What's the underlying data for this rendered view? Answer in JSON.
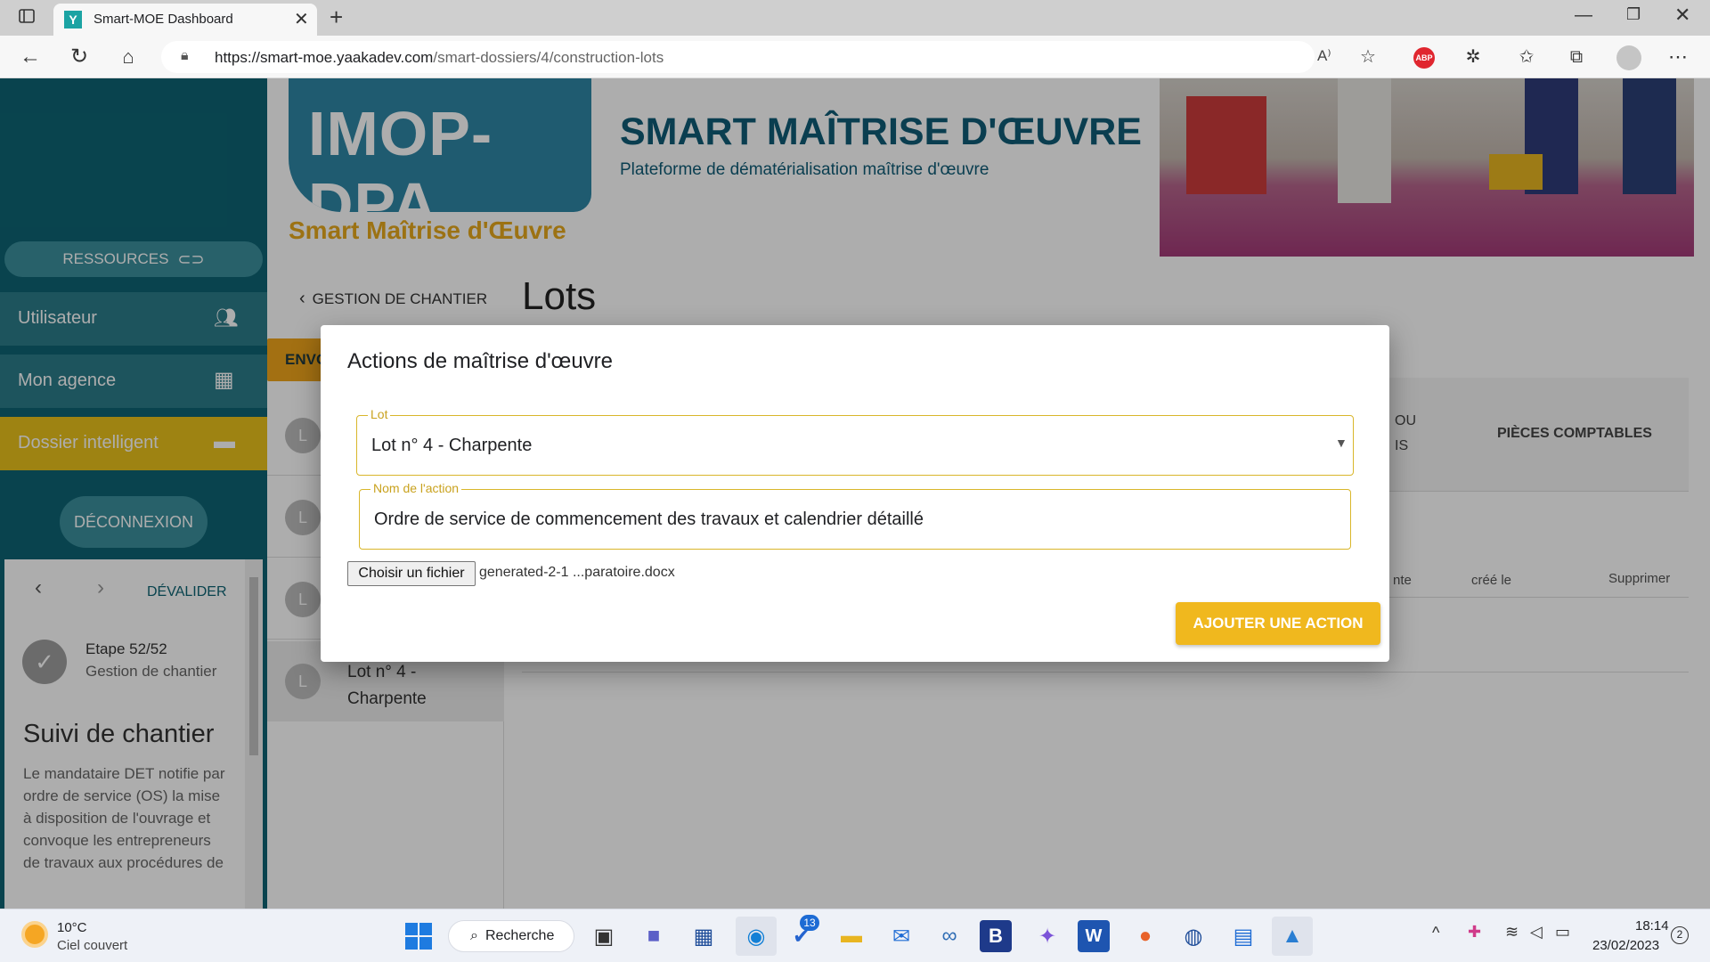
{
  "browser": {
    "tab_title": "Smart-MOE Dashboard",
    "tab_favicon": "Y",
    "url_host": "https://smart-moe.yaakadev.com",
    "url_path": "/smart-dossiers/4/construction-lots"
  },
  "header": {
    "logo_text": "IMOP-DPA",
    "logo_subtitle": "Smart Maîtrise d'Œuvre",
    "title": "SMART MAÎTRISE D'ŒUVRE",
    "subtitle": "Plateforme de dématérialisation maîtrise d'œuvre"
  },
  "sidebar": {
    "resources_label": "RESSOURCES",
    "items": [
      {
        "label": "Utilisateur"
      },
      {
        "label": "Mon agence"
      },
      {
        "label": "Dossier intelligent"
      }
    ],
    "logout_label": "DÉCONNEXION",
    "stepper": {
      "devalider_label": "DÉVALIDER",
      "step_label": "Etape 52/52",
      "step_name": "Gestion de chantier",
      "section_title": "Suivi de chantier",
      "description": "Le mandataire DET notifie par ordre de service (OS) la mise à disposition de l'ouvrage et convoque les entrepreneurs de travaux aux procédures de"
    }
  },
  "main": {
    "back_label": "GESTION DE CHANTIER",
    "page_title": "Lots",
    "orange_button_label": "ENVO",
    "lot_list": [
      {
        "avatar": "L",
        "label": ""
      },
      {
        "avatar": "L",
        "label": ""
      },
      {
        "avatar": "L",
        "label": ""
      },
      {
        "avatar": "L",
        "label": "Lot n° 4 - Charpente"
      }
    ],
    "tabs": {
      "partial_tab_1": "OU",
      "partial_tab_2": "IS",
      "pieces_label": "PIÈCES COMPTABLES"
    },
    "table_headers": {
      "partial": "nte",
      "created": "créé le",
      "delete": "Supprimer"
    }
  },
  "modal": {
    "title": "Actions de maîtrise d'œuvre",
    "lot_label": "Lot",
    "lot_value": "Lot n° 4 - Charpente",
    "action_label": "Nom de l'action",
    "action_value": "Ordre de service de commencement des travaux et calendrier détaillé",
    "file_button": "Choisir un fichier",
    "file_name": "generated-2-1 ...paratoire.docx",
    "submit_label": "AJOUTER UNE ACTION"
  },
  "taskbar": {
    "weather_temp": "10°C",
    "weather_desc": "Ciel couvert",
    "search_label": "Recherche",
    "todo_badge": "13",
    "time": "18:14",
    "date": "23/02/2023",
    "notif_count": "2"
  },
  "colors": {
    "sidebar": "#0e6473",
    "accent_yellow": "#f0b81e",
    "dossier_yellow": "#e9c21b",
    "orange": "#f0a51b",
    "title_blue": "#0f5c77"
  }
}
